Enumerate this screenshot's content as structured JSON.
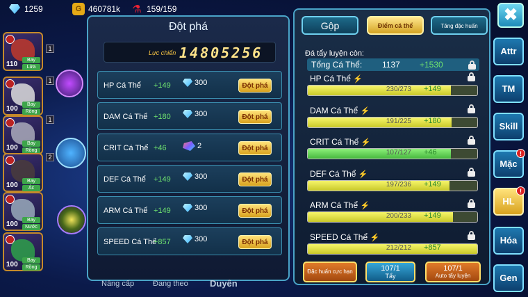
{
  "topbar": {
    "diamonds": "1259",
    "gold": "460781k",
    "stamina": "159/159",
    "icons": [
      "diamond-icon",
      "gold-coin-icon",
      "potion-icon"
    ]
  },
  "pets": [
    {
      "level": "110",
      "tag1": "Bay",
      "tag2": "Lửa",
      "color": "#c0392b",
      "num": "1"
    },
    {
      "level": "100",
      "tag1": "Bay",
      "tag2": "Rồng",
      "color": "#ddd",
      "num": "1"
    },
    {
      "level": "100",
      "tag1": "Bay",
      "tag2": "Rồng",
      "color": "#aab",
      "num": "1"
    },
    {
      "level": "100",
      "tag1": "Bay",
      "tag2": "Ác",
      "color": "#4a3c3c",
      "num": "2"
    },
    {
      "level": "100",
      "tag1": "Bay",
      "tag2": "Nước",
      "color": "#9ab",
      "num": ""
    },
    {
      "level": "100",
      "tag1": "Bay",
      "tag2": "Rồng",
      "color": "#2ea04a",
      "num": ""
    }
  ],
  "pet_nums_top": [
    "1",
    "2"
  ],
  "breakthrough": {
    "title": "Đột phá",
    "power_label": "Lực chiến",
    "power_value": "14805256",
    "button_label": "Đột phá",
    "rows": [
      {
        "name": "HP Cá Thể",
        "plus": "+149",
        "cost": "300",
        "cost_icon": "diamond"
      },
      {
        "name": "DAM Cá Thể",
        "plus": "+180",
        "cost": "300",
        "cost_icon": "diamond"
      },
      {
        "name": "CRIT Cá Thể",
        "plus": "+46",
        "cost": "2",
        "cost_icon": "stone"
      },
      {
        "name": "DEF Cá Thể",
        "plus": "+149",
        "cost": "300",
        "cost_icon": "diamond"
      },
      {
        "name": "ARM Cá Thể",
        "plus": "+149",
        "cost": "300",
        "cost_icon": "diamond"
      },
      {
        "name": "SPEED Cá Thể",
        "plus": "+857",
        "cost": "300",
        "cost_icon": "diamond"
      }
    ]
  },
  "bottom_labels": [
    "Nâng cấp",
    "Đang theo",
    "Duyên"
  ],
  "training": {
    "tabs": [
      "Gộp",
      "Điểm cá thể",
      "Tăng đặc huấn"
    ],
    "remaining_label": "Đá tẩy luyện còn:",
    "total_label": "Tổng Cá Thể:",
    "total_value": "1137",
    "total_plus": "+1530",
    "stats": [
      {
        "name": "HP Cá Thể",
        "current": 230,
        "max": 273,
        "text": "230/273",
        "plus": "+149",
        "state": "yellow"
      },
      {
        "name": "DAM Cá Thể",
        "current": 191,
        "max": 225,
        "text": "191/225",
        "plus": "+180",
        "state": "yellow"
      },
      {
        "name": "CRIT Cá Thể",
        "current": 107,
        "max": 127,
        "text": "107/127",
        "plus": "+46",
        "state": "green"
      },
      {
        "name": "DEF Cá Thể",
        "current": 197,
        "max": 236,
        "text": "197/236",
        "plus": "+149",
        "state": "yellow"
      },
      {
        "name": "ARM Cá Thể",
        "current": 200,
        "max": 233,
        "text": "200/233",
        "plus": "+149",
        "state": "yellow"
      },
      {
        "name": "SPEED Cá Thể",
        "current": 212,
        "max": 212,
        "text": "212/212",
        "plus": "+857",
        "state": "yellow"
      }
    ],
    "buttons": {
      "special": "Đặc huấn cực hạn",
      "wash_count": "107/1",
      "wash": "Tẩy",
      "auto_count": "107/1",
      "auto": "Auto tẩy luyện"
    }
  },
  "side_menu": [
    {
      "label": "Attr",
      "badge": ""
    },
    {
      "label": "TM",
      "badge": ""
    },
    {
      "label": "Skill",
      "badge": ""
    },
    {
      "label": "Mặc",
      "badge": "!"
    },
    {
      "label": "HL",
      "badge": "!"
    },
    {
      "label": "Hóa",
      "badge": ""
    },
    {
      "label": "Gen",
      "badge": ""
    }
  ],
  "close_label": "✖"
}
